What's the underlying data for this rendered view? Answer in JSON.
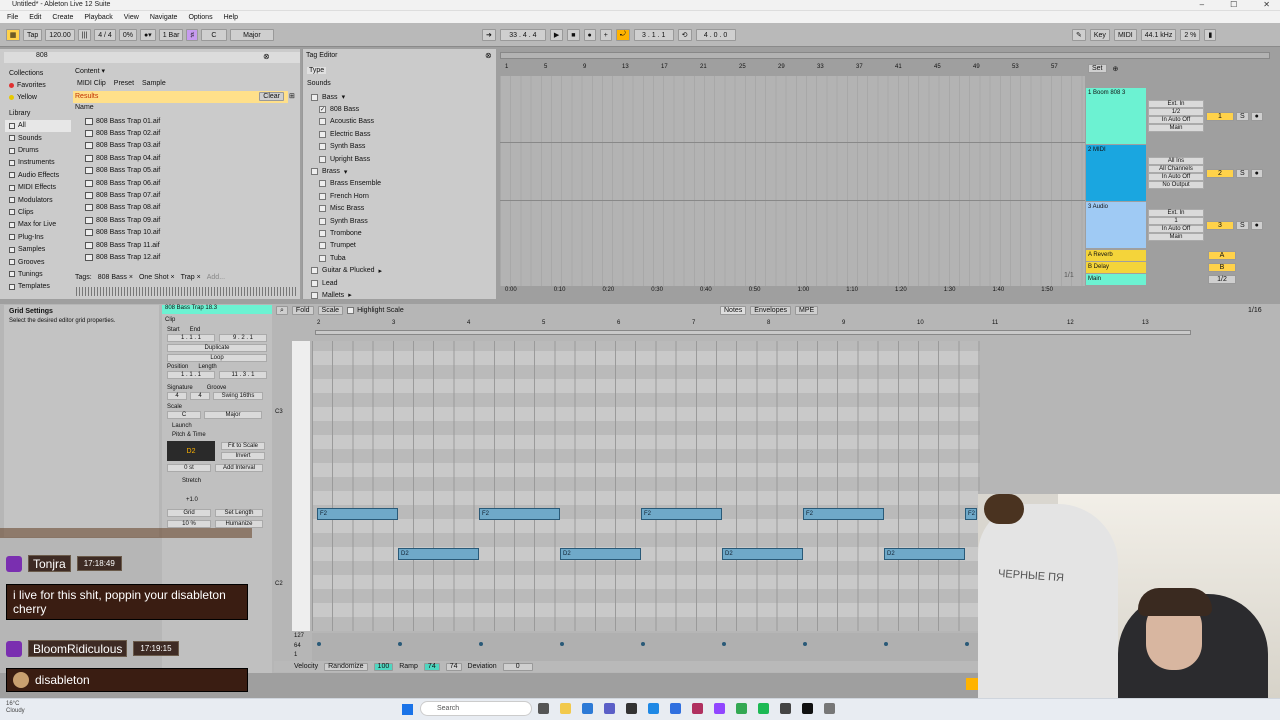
{
  "window": {
    "title": "Untitled* - Ableton Live 12 Suite"
  },
  "menu": [
    "File",
    "Edit",
    "Create",
    "Playback",
    "View",
    "Navigate",
    "Options",
    "Help"
  ],
  "transport": {
    "tap": "Tap",
    "tempo": "120.00",
    "signature": "4 / 4",
    "swing": "0%",
    "quantize": "1 Bar",
    "key_root": "C",
    "scale": "Major",
    "position": "33 .  4 .  4",
    "loop_start": "3 .  1 .  1",
    "loop_length": "4 .  0 .  0",
    "key": "Key",
    "midi": "MIDI",
    "sample_rate": "44.1 kHz",
    "cpu": "2 %"
  },
  "browser": {
    "search": "808",
    "collections_label": "Collections",
    "collections": [
      {
        "label": "Favorites",
        "color": "#e03030"
      },
      {
        "label": "Yellow",
        "color": "#e6c800"
      }
    ],
    "library_label": "Library",
    "library": [
      "All",
      "Sounds",
      "Drums",
      "Instruments",
      "Audio Effects",
      "MIDI Effects",
      "Modulators",
      "Clips",
      "Max for Live",
      "Plug-Ins",
      "Samples",
      "Grooves",
      "Tunings",
      "Templates"
    ],
    "content_label": "Content",
    "filters": [
      "MIDI Clip",
      "Preset",
      "Sample"
    ],
    "results_label": "Results",
    "clear": "Clear",
    "name_col": "Name",
    "files": [
      "808 Bass Trap 01.aif",
      "808 Bass Trap 02.aif",
      "808 Bass Trap 03.aif",
      "808 Bass Trap 04.aif",
      "808 Bass Trap 05.aif",
      "808 Bass Trap 06.aif",
      "808 Bass Trap 07.aif",
      "808 Bass Trap 08.aif",
      "808 Bass Trap 09.aif",
      "808 Bass Trap 10.aif",
      "808 Bass Trap 11.aif",
      "808 Bass Trap 12.aif"
    ],
    "tags_label": "Tags:",
    "tags": [
      "808 Bass ×",
      "One Shot ×",
      "Trap ×",
      "Add..."
    ]
  },
  "tag_editor": {
    "title": "Tag Editor",
    "type": "Type",
    "sounds": "Sounds",
    "groups": [
      {
        "label": "Bass",
        "items": [
          {
            "label": "808 Bass",
            "checked": true
          },
          {
            "label": "Acoustic Bass"
          },
          {
            "label": "Electric Bass"
          },
          {
            "label": "Synth Bass"
          },
          {
            "label": "Upright Bass"
          }
        ]
      },
      {
        "label": "Brass",
        "items": [
          {
            "label": "Brass Ensemble"
          },
          {
            "label": "French Horn"
          },
          {
            "label": "Misc Brass"
          },
          {
            "label": "Synth Brass"
          },
          {
            "label": "Trombone"
          },
          {
            "label": "Trumpet"
          },
          {
            "label": "Tuba"
          }
        ]
      }
    ],
    "more": [
      "Guitar & Plucked",
      "Lead",
      "Mallets"
    ]
  },
  "arrangement": {
    "bars": [
      "1",
      "5",
      "9",
      "13",
      "17",
      "21",
      "25",
      "29",
      "33",
      "37",
      "41",
      "45",
      "49",
      "53",
      "57"
    ],
    "times": [
      "0:00",
      "0:10",
      "0:20",
      "0:30",
      "0:40",
      "0:50",
      "1:00",
      "1:10",
      "1:20",
      "1:30",
      "1:40",
      "1:50"
    ],
    "set": "Set",
    "tracks": [
      {
        "name": "1 Boom 808 3",
        "color": "#6cf2d2",
        "input": "Ext. In",
        "ch": "1/2",
        "mon": "In Auto Off",
        "out": "Main",
        "num": "1"
      },
      {
        "name": "2 MIDI",
        "color": "#1aa6e0",
        "input": "All Ins",
        "ch": "All Channels",
        "mon": "In Auto Off",
        "out": "No Output",
        "num": "2"
      },
      {
        "name": "3 Audio",
        "color": "#9fcaf4",
        "input": "Ext. In",
        "ch": "1",
        "mon": "In Auto Off",
        "out": "Main",
        "num": "3"
      },
      {
        "name": "A Reverb",
        "color": "#f4d43a",
        "num": "A"
      },
      {
        "name": "B Delay",
        "color": "#f4d43a",
        "num": "B"
      },
      {
        "name": "Main",
        "color": "#6cf2d2",
        "num": "1/2"
      }
    ],
    "fraction": "1/1"
  },
  "info": {
    "title": "Grid Settings",
    "text": "Select the desired editor grid properties."
  },
  "clip": {
    "name": "808 Bass Trap 18.3",
    "clip_label": "Clip",
    "start": "Start",
    "end": "End",
    "set": "Set",
    "start_val": "1 .  1 .  1",
    "end_val": "9 .  2 .  1",
    "duplicate": "Duplicate",
    "loop": "Loop",
    "position": "Position",
    "length": "Length",
    "pos_val": "1 .  1 .  1",
    "len_val": "11 .  3 .  1",
    "signature": "Signature",
    "groove": "Groove",
    "sig1": "4",
    "sig2": "4",
    "groove_val": "Swing 16ths",
    "scale": "Scale",
    "scale_root": "C",
    "scale_name": "Major",
    "launch": "Launch",
    "pitch_time": "Pitch & Time",
    "note": "D2",
    "fit": "Fit to Scale",
    "invert": "Invert",
    "transpose": "0 st",
    "add_interval": "Add Interval",
    "stretch": "Stretch",
    "stretch_val": "+1.0",
    "grid": "Grid",
    "set_length": "Set Length",
    "humanize_pct": "10 %",
    "humanize": "Humanize"
  },
  "midi_editor": {
    "fold": "Fold",
    "scale": "Scale",
    "highlight": "Highlight Scale",
    "tabs": [
      "Notes",
      "Envelopes",
      "MPE"
    ],
    "fraction": "1/16",
    "bars": [
      "2",
      "3",
      "4",
      "5",
      "6",
      "7",
      "8",
      "9",
      "10",
      "11",
      "12",
      "13"
    ],
    "keys": [
      "C3",
      "C2"
    ],
    "notes": [
      {
        "pitch": "F2",
        "row": 0,
        "start": 0,
        "len": 1
      },
      {
        "pitch": "F2",
        "row": 0,
        "start": 2,
        "len": 1
      },
      {
        "pitch": "F2",
        "row": 0,
        "start": 4,
        "len": 1
      },
      {
        "pitch": "F2",
        "row": 0,
        "start": 6,
        "len": 1
      },
      {
        "pitch": "F2",
        "row": 0,
        "start": 8,
        "len": 0.15
      },
      {
        "pitch": "D2",
        "row": 1,
        "start": 1,
        "len": 1
      },
      {
        "pitch": "D2",
        "row": 1,
        "start": 3,
        "len": 1
      },
      {
        "pitch": "D2",
        "row": 1,
        "start": 5,
        "len": 1
      },
      {
        "pitch": "D2",
        "row": 1,
        "start": 7,
        "len": 1
      }
    ],
    "vel_max": "127",
    "vel_mid": "64",
    "vel_min": "1",
    "velocity": "Velocity",
    "randomize": "Randomize",
    "rand_val": "100",
    "ramp": "Ramp",
    "ramp1": "74",
    "ramp2": "74",
    "deviation": "Deviation",
    "dev_val": "0"
  },
  "chat": [
    {
      "user": "Tonjra",
      "time": "17:18:49",
      "message": "i live for this shit, poppin your disableton cherry"
    },
    {
      "user": "BloomRidiculous",
      "time": "17:19:15",
      "message": "disableton"
    }
  ],
  "webcam": {
    "shirt_text": "ЧЕРНЫЕ ПЯ"
  },
  "taskbar": {
    "weather_temp": "16°C",
    "weather": "Cloudy",
    "search": "Search"
  }
}
